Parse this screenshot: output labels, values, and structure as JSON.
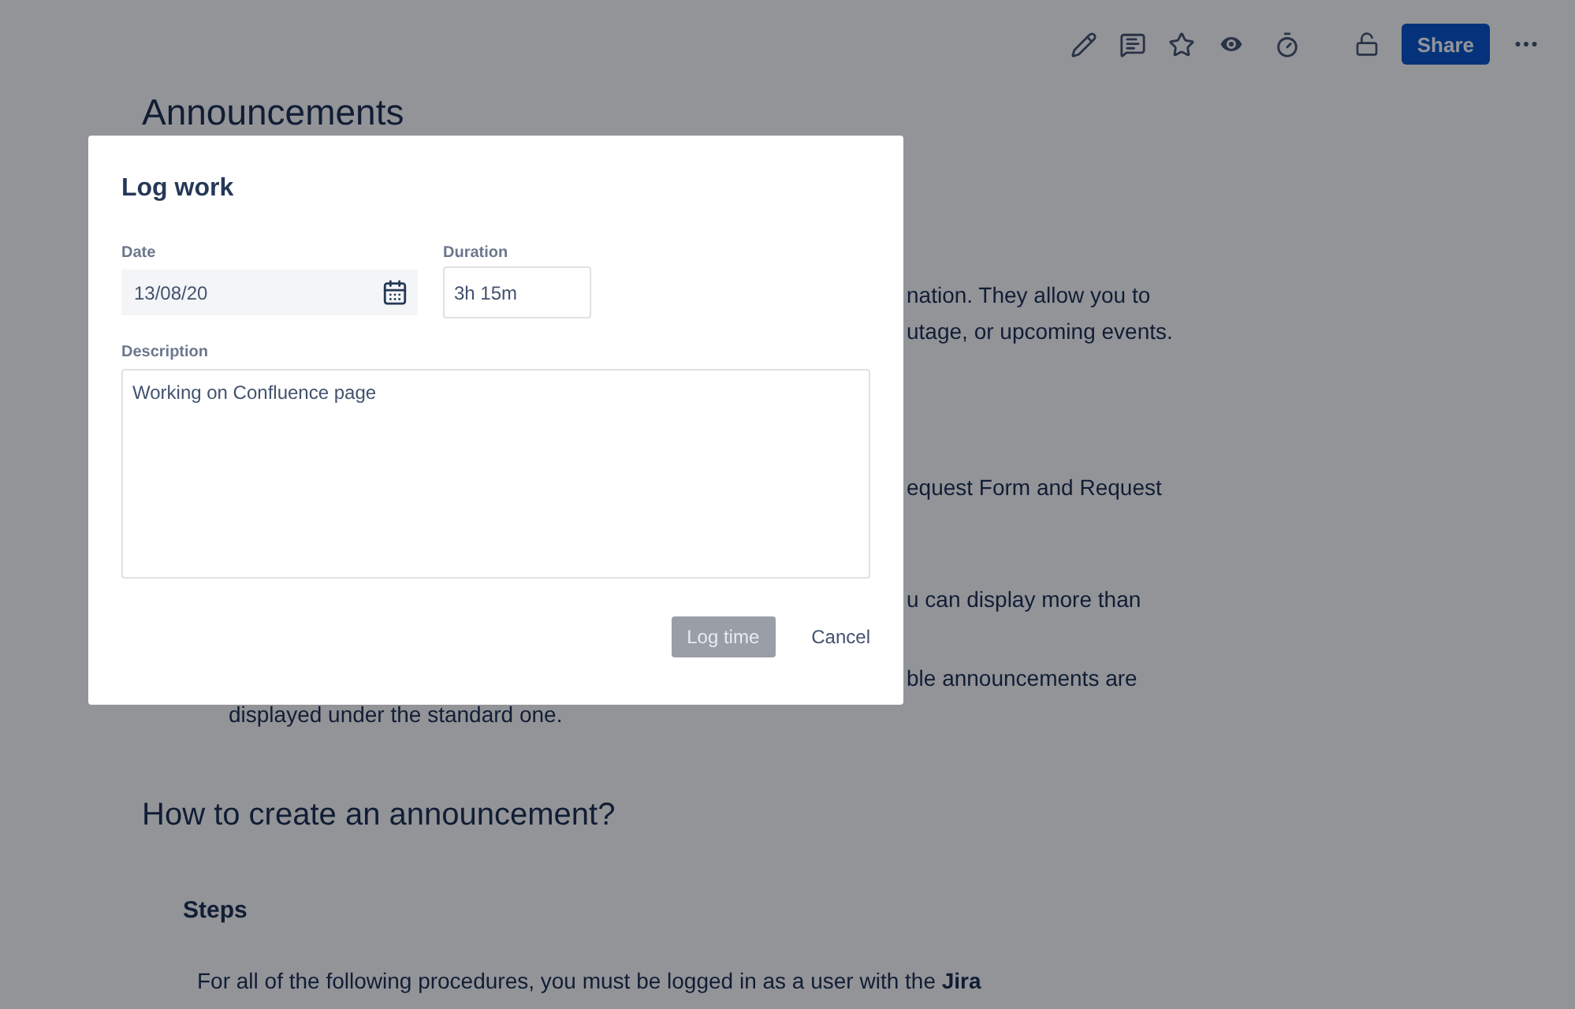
{
  "toolbar": {
    "share_label": "Share",
    "watching": true
  },
  "page": {
    "title": "Announcements",
    "visible_fragments": [
      "nation. They allow you to",
      "utage, or upcoming events.",
      "equest Form and Request",
      "u can display more than",
      "ble announcements are"
    ],
    "indented_line": "displayed under the standard one.",
    "section_heading": "How to create an announcement?",
    "subheading": "Steps",
    "paragraph": "For all of the following procedures, you must be logged in as a user with the **Jira**"
  },
  "dialog": {
    "title": "Log work",
    "date": {
      "label": "Date",
      "value": "13/08/20"
    },
    "duration": {
      "label": "Duration",
      "value": "3h 15m"
    },
    "description": {
      "label": "Description",
      "value": "Working on Confluence page"
    },
    "buttons": [
      {
        "label": "Log time",
        "kind": "primary",
        "disabled": true
      },
      {
        "label": "Cancel",
        "kind": "subtle",
        "disabled": false
      }
    ]
  }
}
